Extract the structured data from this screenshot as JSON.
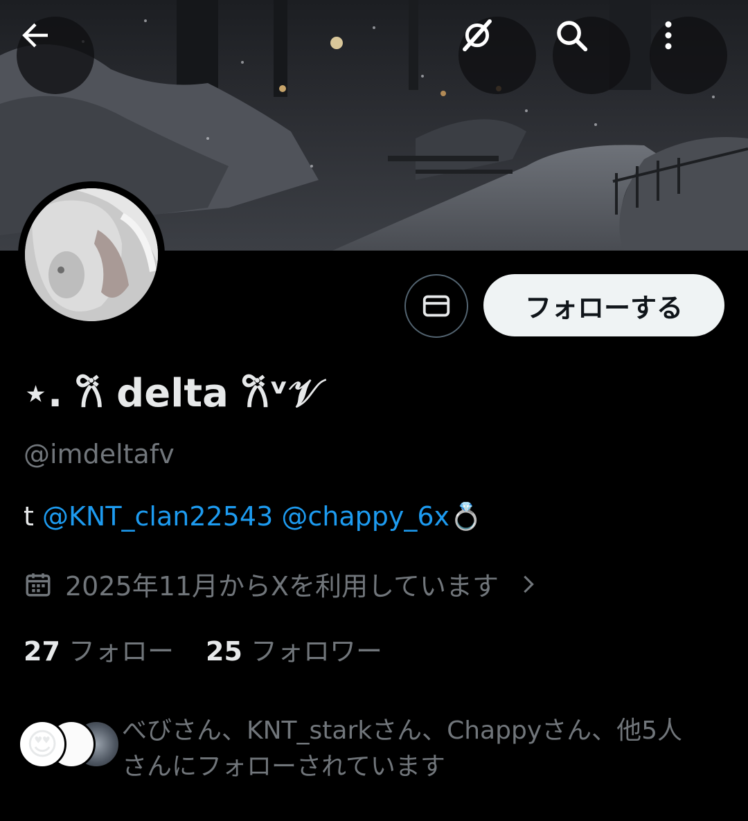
{
  "header": {
    "back_icon": "arrow-left-icon",
    "grok_icon": "grok-icon",
    "search_icon": "search-icon",
    "more_icon": "more-vertical-icon"
  },
  "actions": {
    "message_icon": "envelope-icon",
    "follow_label": "フォローする"
  },
  "profile": {
    "display_name": "⋆. 𐙚 delta 𐙚ᵛ𝒱",
    "handle": "@imdeltafv",
    "bio_prefix": "t ",
    "bio_mention_1": "@KNT_clan22543",
    "bio_mention_2": "@chappy_6x",
    "bio_emoji": "💍",
    "joined": "2025年11月からXを利用しています",
    "following_count": "27",
    "following_label": "フォロー",
    "followers_count": "25",
    "followers_label": "フォロワー"
  },
  "followed_by": {
    "text_line1": "べびさん、KNT_starkさん、Chappyさん、他5人",
    "text_line2": "さんにフォローされています",
    "first_avatar_emoji": "😍"
  },
  "colors": {
    "background": "#000000",
    "mention": "#1d9bf0",
    "secondary_text": "#71767b",
    "follow_button_bg": "#eff3f4"
  }
}
